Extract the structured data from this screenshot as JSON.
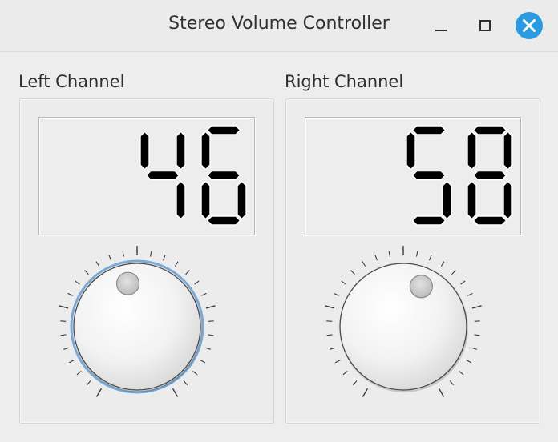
{
  "window": {
    "title": "Stereo Volume Controller",
    "controls": [
      "minimize-icon",
      "maximize-icon",
      "close-icon"
    ],
    "close_color": "#2a9be0"
  },
  "channels": [
    {
      "label": "Left Channel",
      "value": "46",
      "focused": true
    },
    {
      "label": "Right Channel",
      "value": "58",
      "focused": false
    }
  ],
  "colors": {
    "focus_ring": "#7aa9d6",
    "lcd_digit": "#000000"
  }
}
